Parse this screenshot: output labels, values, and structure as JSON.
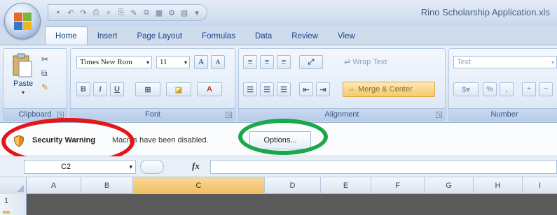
{
  "window": {
    "title": "Rino Scholarship Application.xls"
  },
  "quick_access_toolbar": [
    {
      "name": "save-icon",
      "glyph": "▪"
    },
    {
      "name": "undo-icon",
      "glyph": "↶"
    },
    {
      "name": "redo-icon",
      "glyph": "↷"
    },
    {
      "name": "print-preview-icon",
      "glyph": "⎙"
    },
    {
      "name": "zoom-icon",
      "glyph": "⌕"
    },
    {
      "name": "print-icon",
      "glyph": "⎘"
    },
    {
      "name": "spell-icon",
      "glyph": "✎"
    },
    {
      "name": "copy-icon",
      "glyph": "⧉"
    },
    {
      "name": "table-icon",
      "glyph": "▦"
    },
    {
      "name": "format-icon",
      "glyph": "⚙"
    },
    {
      "name": "chart-icon",
      "glyph": "▤"
    },
    {
      "name": "customize-icon",
      "glyph": "▾"
    }
  ],
  "tabs": [
    "Home",
    "Insert",
    "Page Layout",
    "Formulas",
    "Data",
    "Review",
    "View"
  ],
  "active_tab": "Home",
  "ribbon": {
    "clipboard": {
      "label": "Clipboard",
      "paste": "Paste"
    },
    "font": {
      "label": "Font",
      "name": "Times New Rom",
      "size": "11",
      "grow": "A",
      "shrink": "A",
      "bold": "B",
      "italic": "I",
      "underline": "U",
      "color": "A"
    },
    "alignment": {
      "label": "Alignment",
      "wrap": "Wrap Text",
      "merge": "Merge & Center"
    },
    "number": {
      "label": "Number",
      "format": "Text",
      "percent": "%"
    }
  },
  "security_bar": {
    "title": "Security Warning",
    "message": "Macros have been disabled.",
    "options_label": "Options..."
  },
  "formula_bar": {
    "name_box": "C2",
    "fx": "fx"
  },
  "columns": [
    {
      "label": "A",
      "selected": false
    },
    {
      "label": "B",
      "selected": false
    },
    {
      "label": "C",
      "selected": true
    },
    {
      "label": "D",
      "selected": false
    },
    {
      "label": "E",
      "selected": false
    },
    {
      "label": "F",
      "selected": false
    },
    {
      "label": "G",
      "selected": false
    },
    {
      "label": "H",
      "selected": false
    },
    {
      "label": "I",
      "selected": false
    }
  ],
  "rows": [
    "1"
  ],
  "colors": {
    "highlight_red": "#e3161b",
    "highlight_green": "#1aa84a",
    "selected_header": "#f1be5e"
  }
}
